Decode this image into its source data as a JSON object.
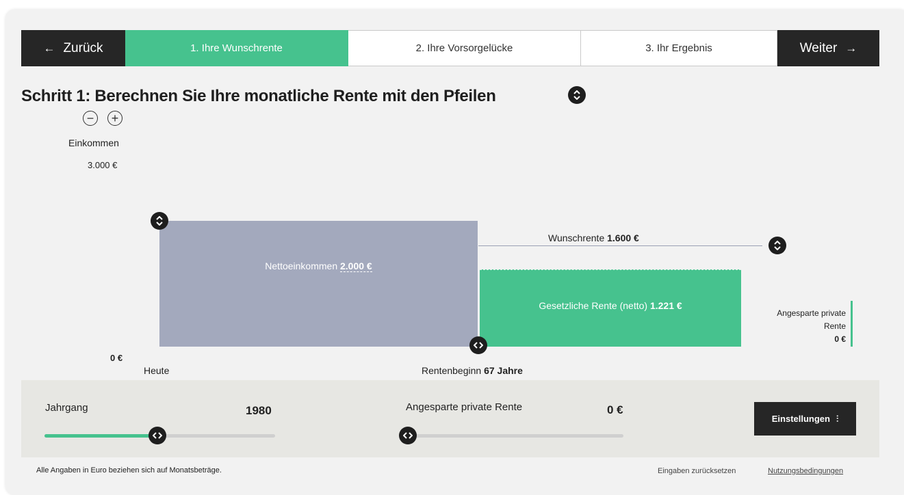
{
  "nav": {
    "back_arrow": "←",
    "back_label": "Zurück",
    "next_label": "Weiter",
    "next_arrow": "→",
    "steps": [
      {
        "label": "1. Ihre Wunschrente",
        "active": true
      },
      {
        "label": "2. Ihre Vorsorgelücke",
        "active": false
      },
      {
        "label": "3. Ihr Ergebnis",
        "active": false
      }
    ]
  },
  "heading": "Schritt 1: Berechnen Sie Ihre monatliche Rente mit den Pfeilen",
  "chart": {
    "y_axis_label": "Einkommen",
    "y_max_label": "3.000 €",
    "y_zero_label": "0 €",
    "x_start_label": "Heute",
    "x_retirement_label": "Rentenbeginn",
    "x_retirement_age": "67 Jahre",
    "net_income_label": "Nettoeinkommen",
    "net_income_value": "2.000 €",
    "wish_pension_label": "Wunschrente",
    "wish_pension_value": "1.600 €",
    "statutory_label": "Gesetzliche Rente (netto)",
    "statutory_value": "1.221 €",
    "private_label_1": "Angesparte private",
    "private_label_2": "Rente",
    "private_value": "0 €"
  },
  "controls": {
    "birth_year_label": "Jahrgang",
    "birth_year_value": "1980",
    "birth_year_slider_fraction": 0.49,
    "private_label": "Angesparte private Rente",
    "private_value": "0 €",
    "private_slider_fraction": 0.0,
    "settings_label": "Einstellungen",
    "settings_icon_glyph": "⫶"
  },
  "footer": {
    "note": "Alle Angaben in Euro beziehen sich auf Monatsbeträge.",
    "reset_label": "Eingaben zurücksetzen",
    "terms_label": "Nutzungsbedingungen"
  },
  "icons": {
    "updown": "⬍",
    "leftright": "‹›",
    "minus": "−",
    "plus": "+"
  },
  "colors": {
    "accent": "#46c28e",
    "dark": "#262626",
    "bar_grey": "#a3a9bd",
    "panel": "#e7e7e3"
  }
}
